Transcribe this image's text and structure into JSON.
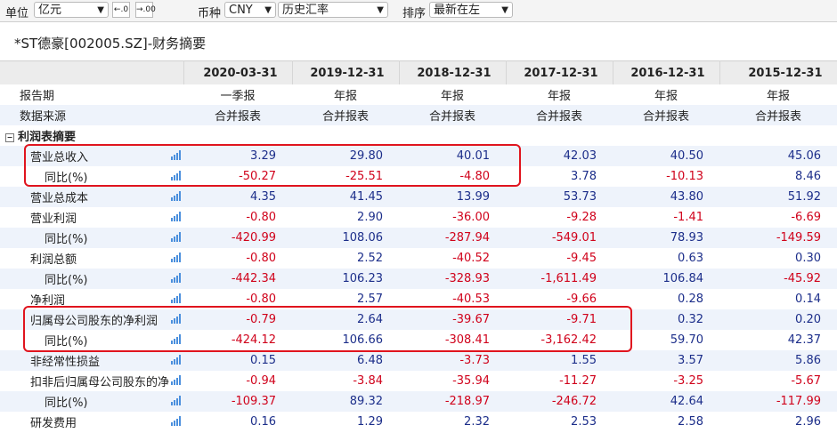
{
  "toolbar": {
    "unit_label": "单位",
    "unit_value": "亿元",
    "currency_label": "币种",
    "currency_value": "CNY",
    "rate_value": "历史汇率",
    "sort_label": "排序",
    "sort_value": "最新在左"
  },
  "title": "*ST德豪[002005.SZ]-财务摘要",
  "columns": [
    "2020-03-31",
    "2019-12-31",
    "2018-12-31",
    "2017-12-31",
    "2016-12-31",
    "2015-12-31"
  ],
  "meta_rows": [
    {
      "label": "报告期",
      "values": [
        "一季报",
        "年报",
        "年报",
        "年报",
        "年报",
        "年报"
      ]
    },
    {
      "label": "数据来源",
      "values": [
        "合并报表",
        "合并报表",
        "合并报表",
        "合并报表",
        "合并报表",
        "合并报表"
      ]
    }
  ],
  "section_label": "利润表摘要",
  "section_toggle": "−",
  "rows": [
    {
      "label": "营业总收入",
      "values": [
        "3.29",
        "29.80",
        "40.01",
        "42.03",
        "40.50",
        "45.06"
      ]
    },
    {
      "label": "同比(%)",
      "values": [
        "-50.27",
        "-25.51",
        "-4.80",
        "3.78",
        "-10.13",
        "8.46"
      ]
    },
    {
      "label": "营业总成本",
      "values": [
        "4.35",
        "41.45",
        "13.99",
        "53.73",
        "43.80",
        "51.92"
      ]
    },
    {
      "label": "营业利润",
      "values": [
        "-0.80",
        "2.90",
        "-36.00",
        "-9.28",
        "-1.41",
        "-6.69"
      ]
    },
    {
      "label": "同比(%)",
      "values": [
        "-420.99",
        "108.06",
        "-287.94",
        "-549.01",
        "78.93",
        "-149.59"
      ]
    },
    {
      "label": "利润总额",
      "values": [
        "-0.80",
        "2.52",
        "-40.52",
        "-9.45",
        "0.63",
        "0.30"
      ]
    },
    {
      "label": "同比(%)",
      "values": [
        "-442.34",
        "106.23",
        "-328.93",
        "-1,611.49",
        "106.84",
        "-45.92"
      ]
    },
    {
      "label": "净利润",
      "values": [
        "-0.80",
        "2.57",
        "-40.53",
        "-9.66",
        "0.28",
        "0.14"
      ]
    },
    {
      "label": "归属母公司股东的净利润",
      "values": [
        "-0.79",
        "2.64",
        "-39.67",
        "-9.71",
        "0.32",
        "0.20"
      ]
    },
    {
      "label": "同比(%)",
      "values": [
        "-424.12",
        "106.66",
        "-308.41",
        "-3,162.42",
        "59.70",
        "42.37"
      ]
    },
    {
      "label": "非经常性损益",
      "values": [
        "0.15",
        "6.48",
        "-3.73",
        "1.55",
        "3.57",
        "5.86"
      ]
    },
    {
      "label": "扣非后归属母公司股东的净",
      "values": [
        "-0.94",
        "-3.84",
        "-35.94",
        "-11.27",
        "-3.25",
        "-5.67"
      ]
    },
    {
      "label": "同比(%)",
      "values": [
        "-109.37",
        "89.32",
        "-218.97",
        "-246.72",
        "42.64",
        "-117.99"
      ]
    },
    {
      "label": "研发费用",
      "values": [
        "0.16",
        "1.29",
        "2.32",
        "2.53",
        "2.58",
        "2.96"
      ]
    }
  ],
  "colors": {
    "negative": "#d0021b",
    "positive": "#1c2e8a",
    "highlight": "#e0141e",
    "alt_row": "#eef3fb"
  },
  "icons": {
    "chart": "bar-chart-icon"
  }
}
